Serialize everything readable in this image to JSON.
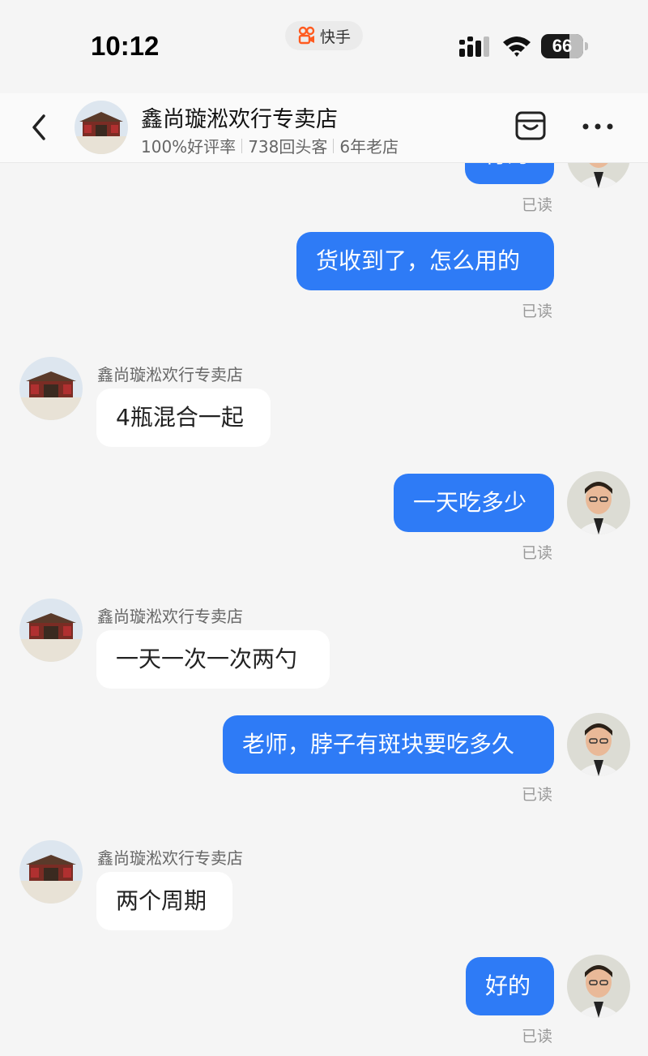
{
  "status_bar": {
    "time": "10:12",
    "app_name": "快手",
    "battery": "66"
  },
  "header": {
    "shop_name": "鑫尚璇淞欢行专卖店",
    "stats": [
      "100%好评率",
      "738回头客",
      "6年老店"
    ]
  },
  "messages": [
    {
      "from": "me",
      "text": "行为",
      "read": "已读"
    },
    {
      "from": "me",
      "text": "货收到了，怎么用的",
      "read": "已读"
    },
    {
      "from": "shop",
      "sender": "鑫尚璇淞欢行专卖店",
      "text": "4瓶混合一起"
    },
    {
      "from": "me",
      "text": "一天吃多少",
      "read": "已读"
    },
    {
      "from": "shop",
      "sender": "鑫尚璇淞欢行专卖店",
      "text": "一天一次一次两勺"
    },
    {
      "from": "me",
      "text": "老师，脖子有斑块要吃多久",
      "read": "已读"
    },
    {
      "from": "shop",
      "sender": "鑫尚璇淞欢行专卖店",
      "text": "两个周期"
    },
    {
      "from": "me",
      "text": "好的",
      "read": "已读"
    }
  ],
  "colors": {
    "my_bubble": "#2e7bf6",
    "shop_bubble": "#ffffff",
    "background": "#f5f5f5"
  }
}
